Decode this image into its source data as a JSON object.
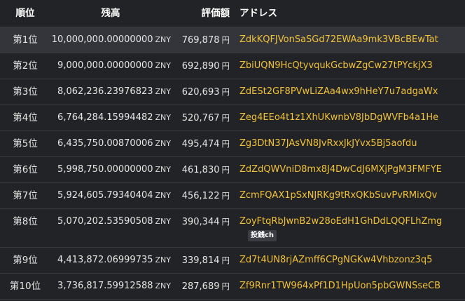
{
  "header": {
    "rank": "順位",
    "balance": "残高",
    "value": "評価額",
    "address": "アドレス"
  },
  "rows": [
    {
      "rank": "第1位",
      "balance": "10,000,000.00000000",
      "balance_unit": "ZNY",
      "value": "769,878",
      "value_unit": "円",
      "address": "ZdkKQFJVonSaSGd72EWAa9mk3VBcBEwTat"
    },
    {
      "rank": "第2位",
      "balance": "9,000,000.00000000",
      "balance_unit": "ZNY",
      "value": "692,890",
      "value_unit": "円",
      "address": "ZbiUQN9HcQtyvqukGcbwZgCw27tPYckjX3"
    },
    {
      "rank": "第3位",
      "balance": "8,062,236.23976823",
      "balance_unit": "ZNY",
      "value": "620,693",
      "value_unit": "円",
      "address": "ZdESt2GF8PVwLiZAa4wx9hHeY7u7adgaWx"
    },
    {
      "rank": "第4位",
      "balance": "6,764,284.15994482",
      "balance_unit": "ZNY",
      "value": "520,767",
      "value_unit": "円",
      "address": "Zeg4EEo4t1z1XhUKwnbV8JbDgWVFb4a1He"
    },
    {
      "rank": "第5位",
      "balance": "6,435,750.00870006",
      "balance_unit": "ZNY",
      "value": "495,474",
      "value_unit": "円",
      "address": "Zg3DtN37JAsVN8JvRxxJkJYvx5Bj5aofdu"
    },
    {
      "rank": "第6位",
      "balance": "5,998,750.00000000",
      "balance_unit": "ZNY",
      "value": "461,830",
      "value_unit": "円",
      "address": "ZdZdQWVniD8mx8J4DwCdJ6MXjPgM3FMFYE"
    },
    {
      "rank": "第7位",
      "balance": "5,924,605.79340404",
      "balance_unit": "ZNY",
      "value": "456,122",
      "value_unit": "円",
      "address": "ZcmFQAX1pSxNJRKg9tRxQKbSuvPvRMixQv"
    },
    {
      "rank": "第8位",
      "balance": "5,070,202.53590508",
      "balance_unit": "ZNY",
      "value": "390,344",
      "value_unit": "円",
      "address": "ZoyFtqRbJwnB2w28oEdH1GhDdLQQFLhZmg",
      "tag": "投銭ch"
    },
    {
      "rank": "第9位",
      "balance": "4,413,872.06999735",
      "balance_unit": "ZNY",
      "value": "339,814",
      "value_unit": "円",
      "address": "Zd7t4UN8rjAZmff6CPgNGKw4Vhbzonz3q5"
    },
    {
      "rank": "第10位",
      "balance": "3,736,817.59912588",
      "balance_unit": "ZNY",
      "value": "287,689",
      "value_unit": "円",
      "address": "Zf9Rnr1TW964xPf1D1HpUon5pbGWNSseCB"
    }
  ],
  "colors": {
    "background": "#222326",
    "highlight_row": "#33353a",
    "address": "#f2c23a",
    "divider": "#3a3b3f"
  }
}
